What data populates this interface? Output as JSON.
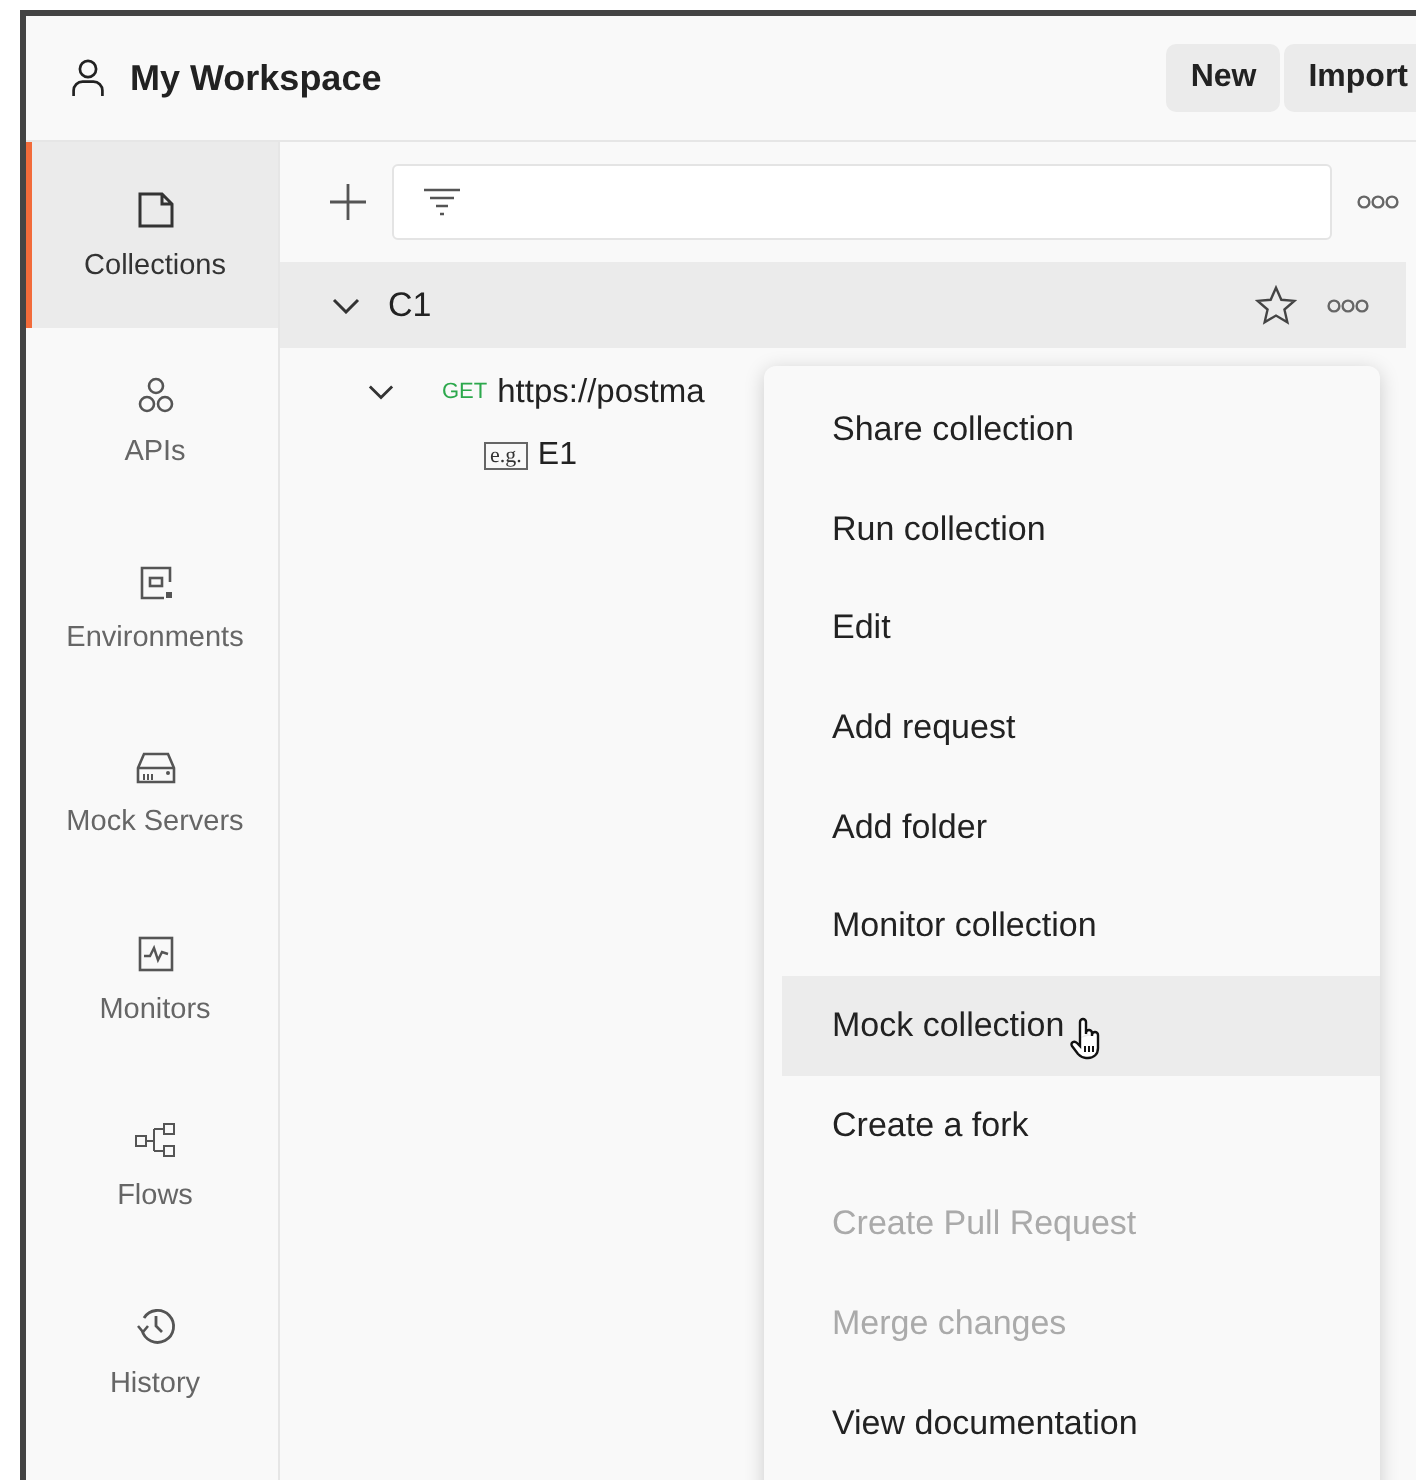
{
  "header": {
    "title": "My Workspace",
    "buttons": [
      "New",
      "Import"
    ]
  },
  "sidebar": {
    "items": [
      {
        "label": "Collections",
        "kind": "collections",
        "selected": true
      },
      {
        "label": "APIs",
        "kind": "apis",
        "selected": false
      },
      {
        "label": "Environments",
        "kind": "environments",
        "selected": false
      },
      {
        "label": "Mock Servers",
        "kind": "mock",
        "selected": false
      },
      {
        "label": "Monitors",
        "kind": "monitors",
        "selected": false
      },
      {
        "label": "Flows",
        "kind": "flows",
        "selected": false
      },
      {
        "label": "History",
        "kind": "history",
        "selected": false
      }
    ]
  },
  "tree": {
    "collection": {
      "name": "C1",
      "expanded": true,
      "children": [
        {
          "method": "GET",
          "name": "https://postma",
          "expanded": true,
          "children": [
            {
              "badge": "e.g.",
              "name": "E1"
            }
          ]
        }
      ]
    }
  },
  "menu": {
    "items": [
      {
        "label": "Share collection",
        "disabled": false,
        "highlighted": false
      },
      {
        "label": "Run collection",
        "disabled": false,
        "highlighted": false
      },
      {
        "label": "Edit",
        "disabled": false,
        "highlighted": false
      },
      {
        "label": "Add request",
        "disabled": false,
        "highlighted": false
      },
      {
        "label": "Add folder",
        "disabled": false,
        "highlighted": false
      },
      {
        "label": "Monitor collection",
        "disabled": false,
        "highlighted": false
      },
      {
        "label": "Mock collection",
        "disabled": false,
        "highlighted": true
      },
      {
        "label": "Create a fork",
        "disabled": false,
        "highlighted": false
      },
      {
        "label": "Create Pull Request",
        "disabled": true,
        "highlighted": false
      },
      {
        "label": "Merge changes",
        "disabled": true,
        "highlighted": false
      },
      {
        "label": "View documentation",
        "disabled": false,
        "highlighted": false
      }
    ]
  }
}
